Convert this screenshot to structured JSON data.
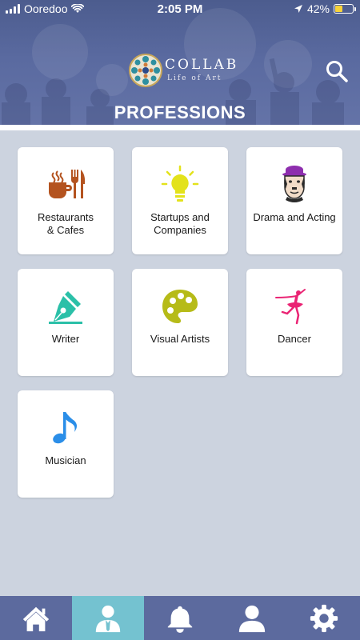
{
  "status_bar": {
    "carrier": "Ooredoo",
    "time": "2:05 PM",
    "battery_percent": "42%",
    "battery_level": 0.42,
    "icons": [
      "signal-bars-icon",
      "wifi-icon",
      "location-arrow-icon",
      "battery-icon"
    ]
  },
  "header": {
    "brand_name": "COLLAB",
    "brand_tagline": "Life of Art",
    "title": "PROFESSIONS",
    "search_icon": "search-icon"
  },
  "professions": [
    {
      "id": "restaurants",
      "label": "Restaurants\n& Cafes",
      "icon": "cup-and-cutlery-icon",
      "color": "#b4531f"
    },
    {
      "id": "startups",
      "label": "Startups and Companies",
      "icon": "lightbulb-icon",
      "color": "#e3e21b"
    },
    {
      "id": "drama",
      "label": "Drama and Acting",
      "icon": "chaplin-face-icon",
      "color": "#8e2eae"
    },
    {
      "id": "writer",
      "label": "Writer",
      "icon": "fountain-pen-icon",
      "color": "#2bc0a8"
    },
    {
      "id": "visual",
      "label": "Visual Artists",
      "icon": "paint-palette-icon",
      "color": "#b6bb18"
    },
    {
      "id": "dancer",
      "label": "Dancer",
      "icon": "ballerina-icon",
      "color": "#ea2474"
    },
    {
      "id": "musician",
      "label": "Musician",
      "icon": "music-note-icon",
      "color": "#2b8ee8"
    }
  ],
  "tab_bar": {
    "tabs": [
      {
        "id": "home",
        "icon": "home-icon",
        "active": false
      },
      {
        "id": "professions",
        "icon": "professional-person-icon",
        "active": true
      },
      {
        "id": "notifications",
        "icon": "bell-icon",
        "active": false
      },
      {
        "id": "profile",
        "icon": "user-icon",
        "active": false
      },
      {
        "id": "settings",
        "icon": "gear-icon",
        "active": false
      }
    ]
  },
  "colors": {
    "header_bg": "#5a6aa0",
    "page_bg": "#ccd3df",
    "tab_bar_bg": "#5c6a9e",
    "tab_active_bg": "#74c2d0",
    "battery_fill": "#f7d23a"
  }
}
